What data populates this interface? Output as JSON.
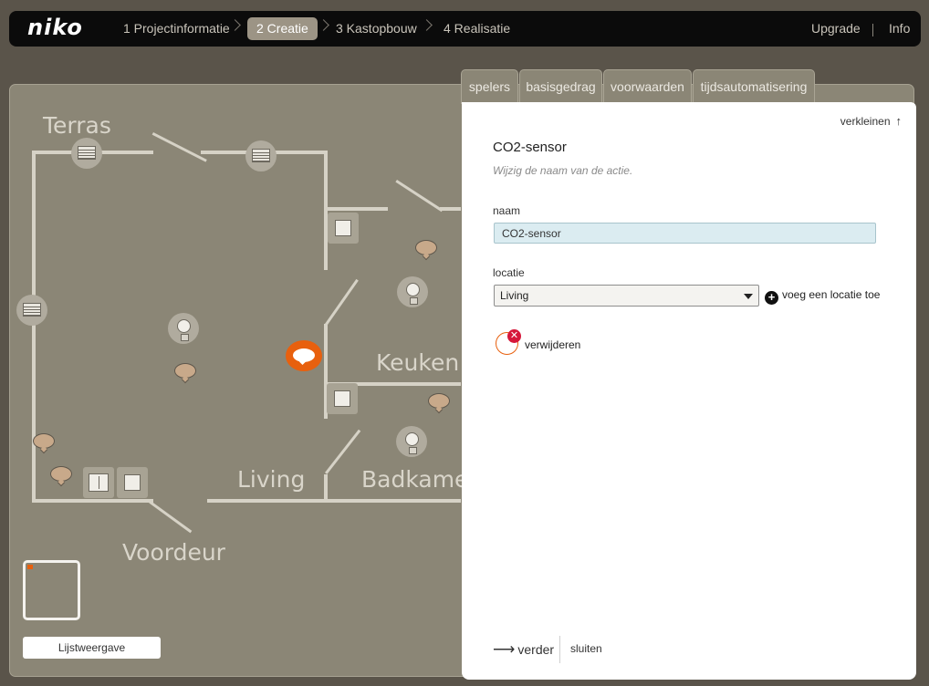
{
  "header": {
    "logo": "niko",
    "steps": [
      "1 Projectinformatie",
      "2 Creatie",
      "3 Kastopbouw",
      "4 Realisatie"
    ],
    "active_step": "2 Creatie",
    "links": [
      "Upgrade",
      "Info"
    ]
  },
  "floorplan": {
    "rooms": [
      "Terras",
      "Keuken",
      "Living",
      "Badkamer",
      "Voordeur"
    ],
    "list_view_button": "Lijstweergave"
  },
  "panel": {
    "tabs": [
      "spelers",
      "basisgedrag",
      "voorwaarden",
      "tijdsautomatisering"
    ],
    "collapse_label": "verkleinen",
    "title": "CO2-sensor",
    "subtitle": "Wijzig de naam van de actie.",
    "name_label": "naam",
    "name_value": "CO2-sensor",
    "location_label": "locatie",
    "location_value": "Living",
    "add_location_label": "voeg een locatie toe",
    "delete_label": "verwijderen",
    "next_label": "verder",
    "close_label": "sluiten"
  },
  "colors": {
    "accent": "#e8600e",
    "delete": "#d6173a",
    "topbar": "#0b0b0b",
    "plan_bg": "#8b8676"
  }
}
